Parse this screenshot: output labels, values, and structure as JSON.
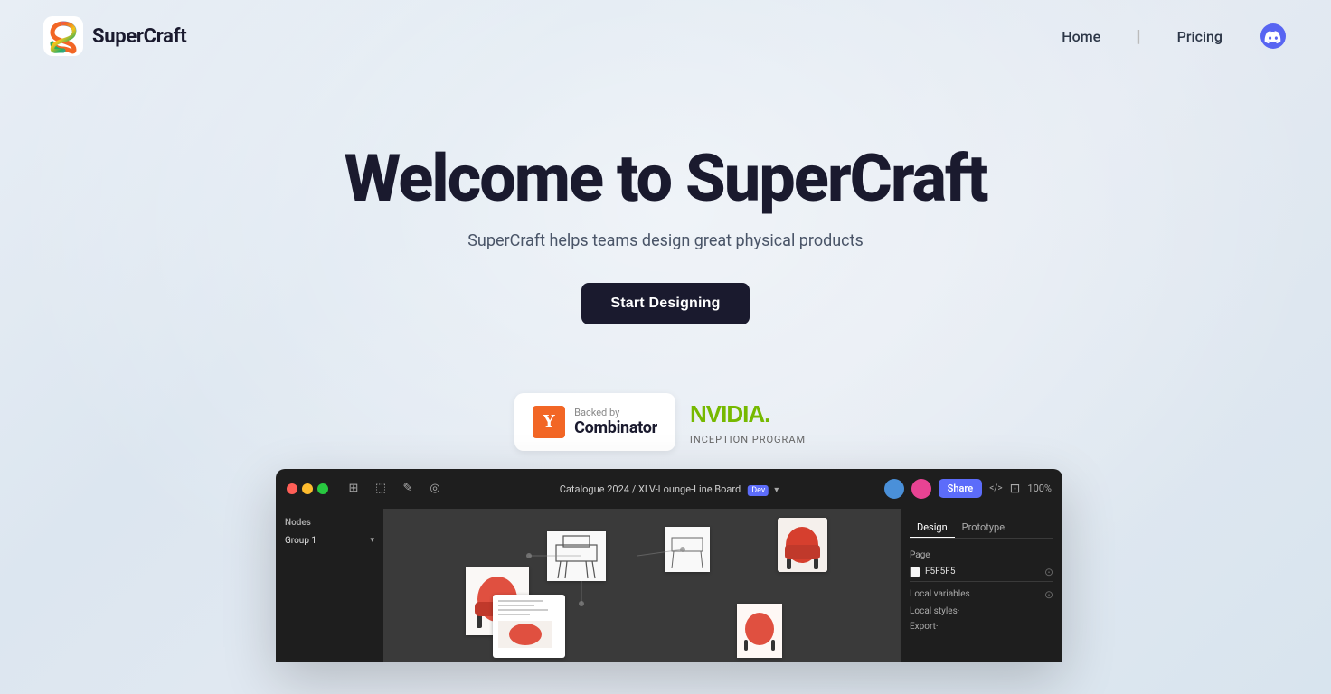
{
  "nav": {
    "logo_text": "SuperCraft",
    "links": [
      {
        "label": "Home",
        "id": "home"
      },
      {
        "label": "Pricing",
        "id": "pricing"
      }
    ],
    "discord_label": "Discord"
  },
  "hero": {
    "title": "Welcome to SuperCraft",
    "subtitle": "SuperCraft helps teams design great physical products",
    "cta_label": "Start Designing"
  },
  "badges": {
    "yc": {
      "backed_by": "Backed by",
      "name": "Combinator"
    },
    "nvidia": {
      "program": "INCEPTION PROGRAM"
    }
  },
  "figma": {
    "file_name": "Catalogue 2024 / XLV-Lounge-Line Board",
    "zoom": "100%",
    "nodes_label": "Nodes",
    "group_label": "Group 1",
    "design_tab": "Design",
    "prototype_tab": "Prototype",
    "page_label": "Page",
    "page_value": "F5F5F5",
    "zoom_value": "100%",
    "local_vars": "Local variables",
    "local_styles": "Local styles·",
    "export": "Export·",
    "share_btn": "Share"
  }
}
